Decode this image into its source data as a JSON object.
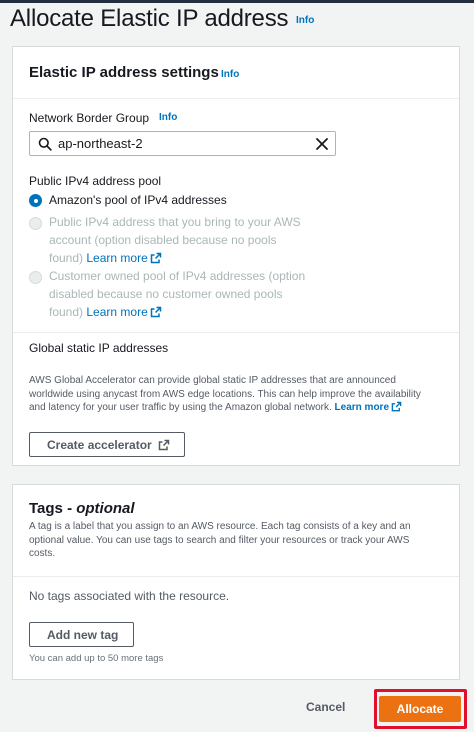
{
  "page": {
    "title": "Allocate Elastic IP address",
    "info": "Info"
  },
  "settings": {
    "title": "Elastic IP address settings",
    "info": "Info",
    "network_border_group": {
      "label": "Network Border Group",
      "info": "Info",
      "value": "ap-northeast-2"
    },
    "pool": {
      "label": "Public IPv4 address pool",
      "options": [
        {
          "lines": [
            "Amazon's pool of IPv4 addresses"
          ],
          "selected": true,
          "disabled": false
        },
        {
          "lines": [
            "Public IPv4 address that you bring to your AWS",
            "account (option disabled because no pools",
            "found)"
          ],
          "link": "Learn more",
          "selected": false,
          "disabled": true
        },
        {
          "lines": [
            "Customer owned pool of IPv4 addresses (option",
            "disabled because no customer owned pools",
            "found)"
          ],
          "link": "Learn more",
          "selected": false,
          "disabled": true
        }
      ]
    },
    "global": {
      "title": "Global static IP addresses",
      "description": [
        "AWS Global Accelerator can provide global static IP addresses that are announced",
        "worldwide using anycast from AWS edge locations. This can help improve the availability",
        "and latency for your user traffic by using the Amazon global network."
      ],
      "link": "Learn more",
      "button": "Create accelerator"
    }
  },
  "tags": {
    "title": "Tags - ",
    "title_optional": "optional",
    "description": [
      "A tag is a label that you assign to an AWS resource. Each tag consists of a key and an",
      "optional value. You can use tags to search and filter your resources or track your AWS",
      "costs."
    ],
    "empty": "No tags associated with the resource.",
    "add_button": "Add new tag",
    "hint": "You can add up to 50 more tags"
  },
  "footer": {
    "cancel": "Cancel",
    "allocate": "Allocate"
  },
  "colors": {
    "accent": "#0073bb",
    "primary_button": "#ec7211",
    "highlight": "#e0102a"
  }
}
